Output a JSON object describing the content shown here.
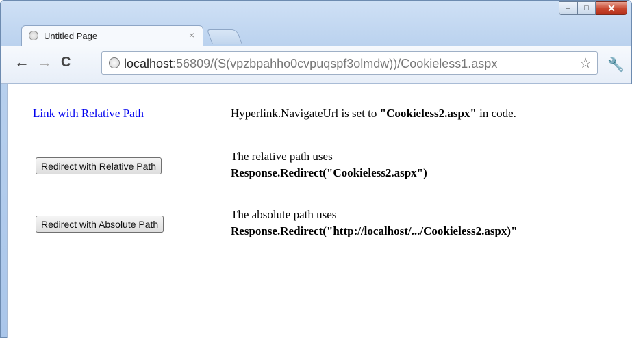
{
  "window": {
    "minimize": "–",
    "maximize": "□",
    "close": "✕"
  },
  "tab": {
    "title": "Untitled Page",
    "close": "×"
  },
  "toolbar": {
    "back": "←",
    "forward": "→",
    "reload": "C",
    "url_host": "localhost",
    "url_rest": ":56809/(S(vpzbpahho0cvpuqspf3olmdw))/Cookieless1.aspx",
    "star": "☆",
    "wrench": "🔧"
  },
  "content": {
    "link_label": "Link with Relative Path",
    "desc1_prefix": "Hyperlink.NavigateUrl is set to ",
    "desc1_bold": "\"Cookieless2.aspx\"",
    "desc1_suffix": " in code.",
    "button1_label": "Redirect with Relative Path",
    "desc2_line1": "The relative path uses",
    "desc2_line2": "Response.Redirect(\"Cookieless2.aspx\")",
    "button2_label": "Redirect with Absolute Path",
    "desc3_line1": "The absolute path uses",
    "desc3_line2": "Response.Redirect(\"http://localhost/.../Cookieless2.aspx)\""
  }
}
